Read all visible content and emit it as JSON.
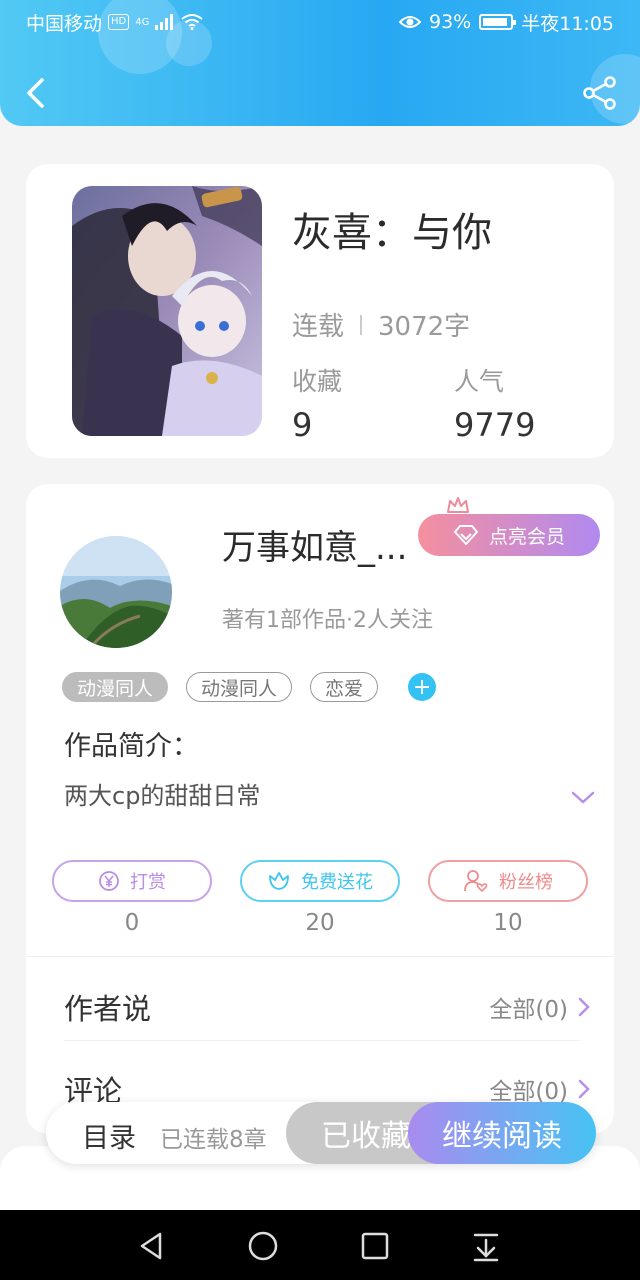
{
  "status_bar": {
    "carrier": "中国移动",
    "hd": "HD",
    "network": "4G",
    "battery": "93%",
    "time": "半夜11:05"
  },
  "colors": {
    "header_gradient_start": "#52c9f4",
    "header_gradient_end": "#27a8f2",
    "accent_blue": "#33c2f1",
    "reward_purple": "#b98de6",
    "flower_cyan": "#3ec6ee",
    "fans_red": "#ef8b8b"
  },
  "header": {
    "back_icon": "chevron-left-icon",
    "share_icon": "share-icon"
  },
  "book": {
    "title": "灰喜：与你",
    "status": "连载",
    "word_count": "3072字",
    "favorites_label": "收藏",
    "favorites_value": "9",
    "popularity_label": "人气",
    "popularity_value": "9779"
  },
  "author": {
    "name": "万事如意_...",
    "vip_label": "点亮会员",
    "meta": "著有1部作品·2人关注",
    "tags": [
      "动漫同人",
      "动漫同人",
      "恋爱"
    ],
    "intro_label": "作品简介：",
    "intro_text": "两大cp的甜甜日常"
  },
  "actions": [
    {
      "label": "打赏",
      "count": "0",
      "icon": "yen-coin-icon"
    },
    {
      "label": "免费送花",
      "count": "20",
      "icon": "flower-icon"
    },
    {
      "label": "粉丝榜",
      "count": "10",
      "icon": "user-heart-icon"
    }
  ],
  "rows": {
    "author_says": "作者说",
    "author_says_link": "全部(0)",
    "comments": "评论",
    "comments_link": "全部(0)"
  },
  "bottom_bar": {
    "toc": "目录",
    "toc_sub": "已连载8章",
    "saved": "已收藏",
    "continue": "继续阅读"
  }
}
